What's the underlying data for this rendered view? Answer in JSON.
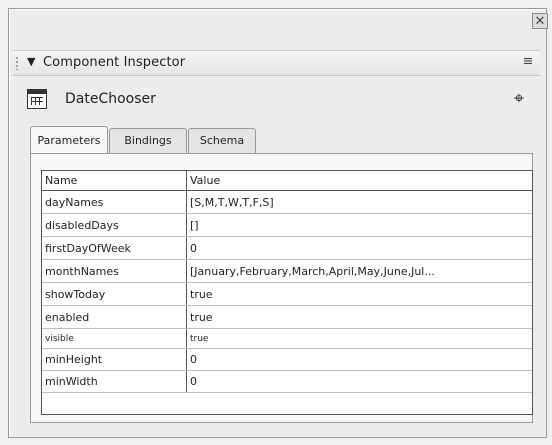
{
  "panel": {
    "title": "Component Inspector",
    "collapse_glyph": "▼",
    "options_glyph": "≡"
  },
  "window": {
    "close_glyph": "✕"
  },
  "component": {
    "name": "DateChooser",
    "icon": "calendar-grid-icon",
    "inspect_glyph": "⌖"
  },
  "tabs": [
    {
      "label": "Parameters",
      "active": true
    },
    {
      "label": "Bindings",
      "active": false
    },
    {
      "label": "Schema",
      "active": false
    }
  ],
  "grid": {
    "headers": {
      "name": "Name",
      "value": "Value"
    },
    "rows": [
      {
        "name": "dayNames",
        "value": "[S,M,T,W,T,F,S]"
      },
      {
        "name": "disabledDays",
        "value": "[]"
      },
      {
        "name": "firstDayOfWeek",
        "value": "0"
      },
      {
        "name": "monthNames",
        "value": "[January,February,March,April,May,June,Jul..."
      },
      {
        "name": "showToday",
        "value": "true"
      },
      {
        "name": "enabled",
        "value": "true"
      },
      {
        "name": "visible",
        "value": "true"
      },
      {
        "name": "minHeight",
        "value": "0"
      },
      {
        "name": "minWidth",
        "value": "0"
      }
    ]
  }
}
